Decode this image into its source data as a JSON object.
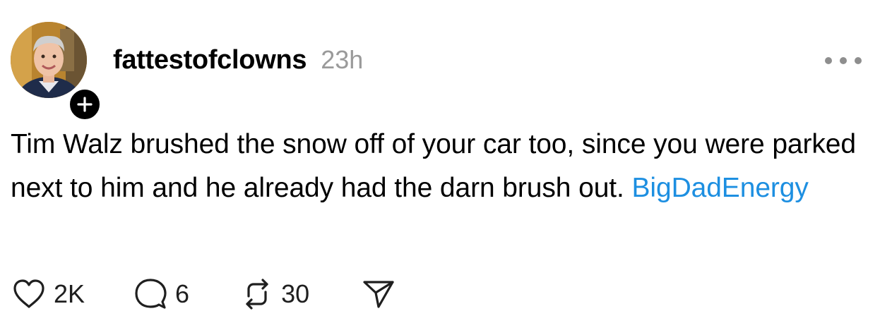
{
  "post": {
    "username": "fattestofclowns",
    "timestamp": "23h",
    "text": "Tim Walz brushed the snow off of your car too, since you were parked next to him and he already had the darn brush out.",
    "hashtag": "BigDadEnergy",
    "hashtag_color": "#1d8fe1",
    "avatar_icon": "profile-photo",
    "follow_icon": "plus-icon",
    "more_icon": "ellipsis-icon"
  },
  "actions": {
    "likes": "2K",
    "replies": "6",
    "reposts": "30",
    "like_icon": "heart-icon",
    "reply_icon": "speech-bubble-icon",
    "repost_icon": "repost-arrows-icon",
    "share_icon": "send-icon"
  }
}
